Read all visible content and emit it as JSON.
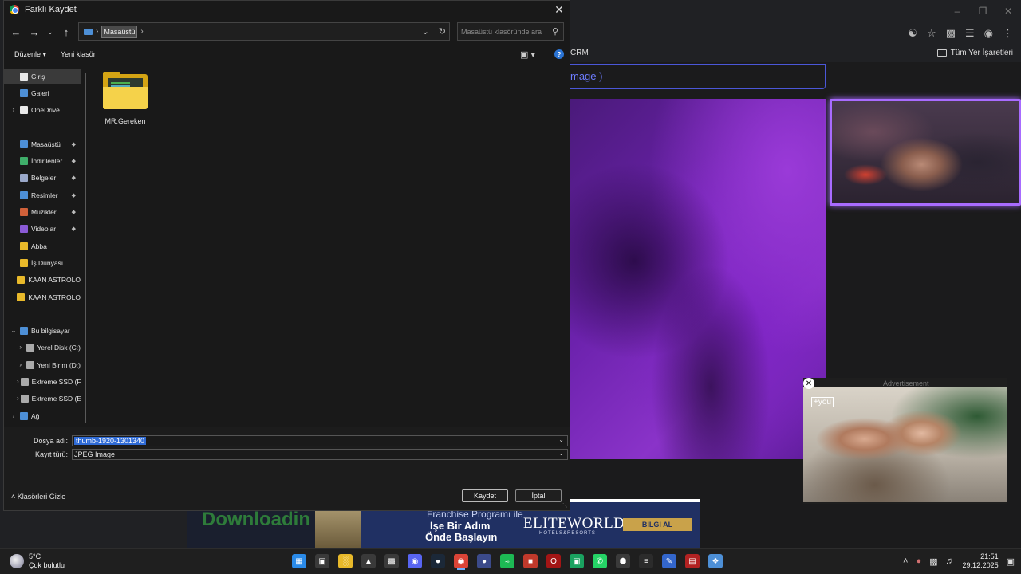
{
  "dialog": {
    "title": "Farklı Kaydet",
    "breadcrumb": "Masaüstü",
    "search_placeholder": "Masaüstü klasöründe ara",
    "toolbar": {
      "organize": "Düzenle",
      "new_folder": "Yeni klasör"
    },
    "sidebar": {
      "items": [
        {
          "label": "Giriş",
          "icon": "home-icon",
          "color": "#e8e8e8",
          "selected": true
        },
        {
          "label": "Galeri",
          "icon": "gallery-icon",
          "color": "#4d8fd6"
        },
        {
          "label": "OneDrive",
          "icon": "document-icon",
          "color": "#e8e8e8"
        },
        {
          "label": "Masaüstü",
          "icon": "desktop-icon",
          "color": "#4d8fd6",
          "pinned": true
        },
        {
          "label": "İndirilenler",
          "icon": "download-icon",
          "color": "#3fae6a",
          "pinned": true
        },
        {
          "label": "Belgeler",
          "icon": "documents-icon",
          "color": "#9aa8c9",
          "pinned": true
        },
        {
          "label": "Resimler",
          "icon": "pictures-icon",
          "color": "#4d8fd6",
          "pinned": true
        },
        {
          "label": "Müzikler",
          "icon": "music-icon",
          "color": "#d0613a",
          "pinned": true
        },
        {
          "label": "Videolar",
          "icon": "videos-icon",
          "color": "#8a5ad6",
          "pinned": true
        },
        {
          "label": "Abba",
          "icon": "folder-icon",
          "color": "#e8b92a"
        },
        {
          "label": "İş Dünyası",
          "icon": "folder-icon",
          "color": "#e8b92a"
        },
        {
          "label": "KAAN ASTROLO",
          "icon": "folder-icon",
          "color": "#e8b92a"
        },
        {
          "label": "KAAN ASTROLO",
          "icon": "folder-icon",
          "color": "#e8b92a"
        },
        {
          "label": "Bu bilgisayar",
          "icon": "computer-icon",
          "color": "#4d8fd6"
        },
        {
          "label": "Yerel Disk (C:)",
          "icon": "drive-icon",
          "color": "#aaaaaa"
        },
        {
          "label": "Yeni Birim (D:)",
          "icon": "drive-icon",
          "color": "#aaaaaa"
        },
        {
          "label": "Extreme SSD (F",
          "icon": "drive-icon",
          "color": "#aaaaaa"
        },
        {
          "label": "Extreme SSD (E:)",
          "icon": "drive-icon",
          "color": "#aaaaaa"
        },
        {
          "label": "Ağ",
          "icon": "network-icon",
          "color": "#4d8fd6"
        }
      ]
    },
    "files": [
      {
        "name": "MR.Gereken",
        "type": "folder"
      }
    ],
    "filename_label": "Dosya adı:",
    "filename_value": "thumb-1920-1301340",
    "filetype_label": "Kayıt türü:",
    "filetype_value": "JPEG Image",
    "save_button": "Kaydet",
    "cancel_button": "İptal",
    "hide_folders": "Klasörleri Gizle"
  },
  "browser": {
    "bookmark_crm": "CRM",
    "bookmark_all": "Tüm Yer İşaretleri",
    "search_fragment": "mage )",
    "ad_label": "Advertisement",
    "ad_logo": "+you",
    "banner": {
      "download_text": "Downloadin",
      "line1": "Franchise Programı ile",
      "line2": "İşe Bir Adım",
      "line3": "Önde Başlayın",
      "brand": "ELITEWORLD",
      "brand_sub": "HOTELS&RESORTS",
      "button": "BİLGİ AL"
    }
  },
  "taskbar": {
    "temperature": "5°C",
    "weather": "Çok bulutlu",
    "time": "21:51",
    "date": "29.12.2025"
  }
}
